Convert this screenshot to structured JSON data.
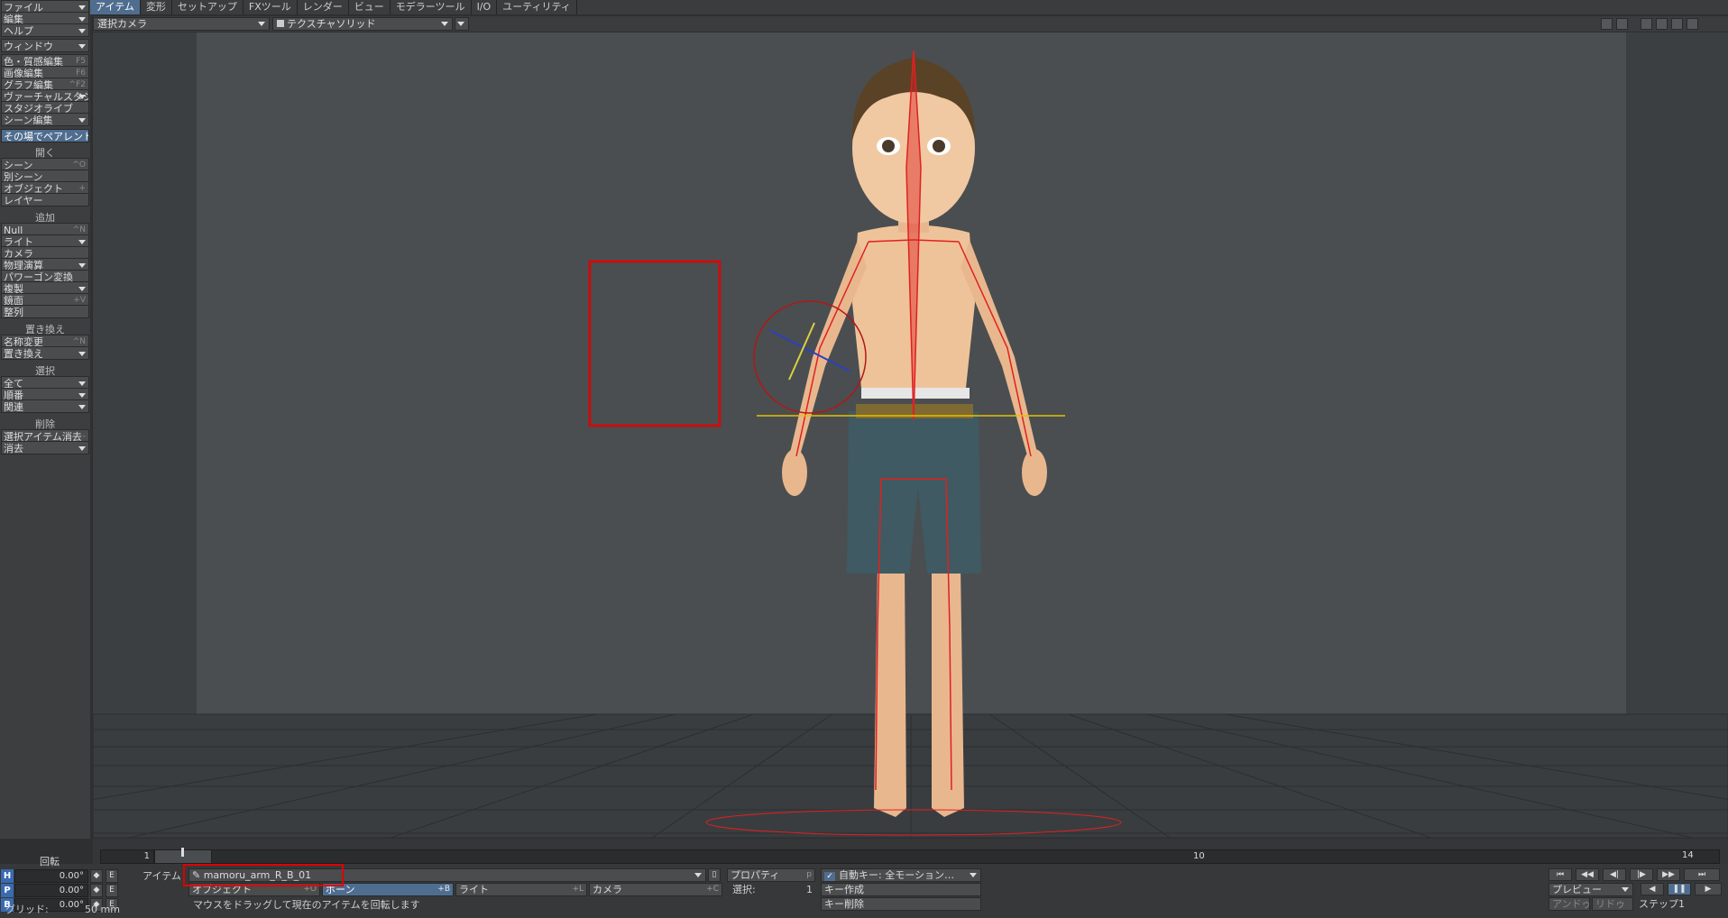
{
  "top_tabs": [
    "アイテム",
    "変形",
    "セットアップ",
    "FXツール",
    "レンダー",
    "ビュー",
    "モデラーツール",
    "I/O",
    "ユーティリティ"
  ],
  "left_top": [
    {
      "label": "ファイル",
      "dropdown": true
    },
    {
      "label": "編集",
      "dropdown": true
    },
    {
      "label": "ヘルプ",
      "dropdown": true
    },
    {
      "label": "ウィンドウ",
      "dropdown": true
    },
    {
      "label": "色・質感編集",
      "shortcut": "F5"
    },
    {
      "label": "画像編集",
      "shortcut": "F6"
    },
    {
      "label": "グラフ編集",
      "shortcut": "^F2"
    },
    {
      "label": "ヴァーチャルスタジオ",
      "dropdown": true
    },
    {
      "label": "スタジオライブ"
    },
    {
      "label": "シーン編集",
      "dropdown": true
    },
    {
      "label": "その場でペアレント"
    }
  ],
  "section_open": {
    "title": "開く",
    "items": [
      {
        "label": "シーン",
        "shortcut": "^O"
      },
      {
        "label": "別シーン"
      },
      {
        "label": "オブジェクト",
        "shortcut": "+"
      },
      {
        "label": "レイヤー"
      }
    ]
  },
  "section_add": {
    "title": "追加",
    "items": [
      {
        "label": "Null",
        "shortcut": "^N"
      },
      {
        "label": "ライト",
        "dropdown": true
      },
      {
        "label": "カメラ"
      },
      {
        "label": "物理演算",
        "dropdown": true
      },
      {
        "label": "パワーゴン変換"
      },
      {
        "label": "複製",
        "dropdown": true
      },
      {
        "label": "鏡面",
        "shortcut": "+V"
      },
      {
        "label": "整列"
      }
    ]
  },
  "section_replace": {
    "title": "置き換え",
    "items": [
      {
        "label": "名称変更",
        "shortcut": "^N"
      },
      {
        "label": "置き換え",
        "dropdown": true
      }
    ]
  },
  "section_select": {
    "title": "選択",
    "items": [
      {
        "label": "全て",
        "dropdown": true
      },
      {
        "label": "順番",
        "dropdown": true
      },
      {
        "label": "関連",
        "dropdown": true
      }
    ]
  },
  "section_delete": {
    "title": "削除",
    "items": [
      {
        "label": "選択アイテム消去",
        "shortcut": "-"
      },
      {
        "label": "消去",
        "dropdown": true
      }
    ]
  },
  "viewport": {
    "camera": "選択カメラ",
    "render_mode": "テクスチャソリッド"
  },
  "rotation": {
    "title": "回転",
    "h": {
      "axis": "H",
      "value": "0.00°"
    },
    "p": {
      "axis": "P",
      "value": "0.00°"
    },
    "b": {
      "axis": "B",
      "value": "0.00°"
    }
  },
  "grid": {
    "label": "グリッド:",
    "value": "50 mm"
  },
  "timeline": {
    "start": "1",
    "mark": "10",
    "end": "14",
    "current": "1"
  },
  "item_selector": {
    "label": "アイテム",
    "current": "mamoru_arm_R_B_01",
    "properties": "プロパティ",
    "properties_shortcut": "p",
    "types": [
      {
        "label": "オブジェクト",
        "shortcut": "+O"
      },
      {
        "label": "ボーン",
        "shortcut": "+B"
      },
      {
        "label": "ライト",
        "shortcut": "+L"
      },
      {
        "label": "カメラ",
        "shortcut": "+C"
      }
    ]
  },
  "selection": {
    "label": "選択:",
    "count": "1"
  },
  "status_message": "マウスをドラッグして現在のアイテムを回転します",
  "auto_key": {
    "label": "自動キー: 全モーション…",
    "checked": true
  },
  "key_create": "キー作成",
  "key_delete": "キー削除",
  "preview": "プレビュー",
  "undo": "アンドゥ",
  "redo": "リドゥ",
  "step": {
    "label": "ステップ",
    "value": "1"
  },
  "colors": {
    "accent": "#4f6d8f",
    "bone": "#e02020",
    "highlight_box": "#e00000"
  }
}
